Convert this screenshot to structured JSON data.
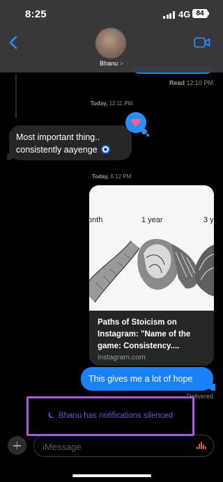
{
  "status_bar": {
    "time": "8:25",
    "network": "4G",
    "battery": "84"
  },
  "header": {
    "contact_name": "Bhanu",
    "contact_chevron": ">"
  },
  "messages": {
    "read_receipt_label": "Read",
    "read_receipt_time": "12:10 PM",
    "timestamp_1_day": "Today,",
    "timestamp_1_time": "12:11 PM",
    "incoming_text": "Most important thing.. consistently aayenge",
    "tapback": "heart",
    "timestamp_2_day": "Today,",
    "timestamp_2_time": "6:12 PM",
    "link_preview": {
      "image_labels": [
        "onth",
        "1 year",
        "3 y"
      ],
      "title": "Paths of Stoicism on Instagram: \"Name of the game: Consistency....",
      "domain": "instagram.com"
    },
    "outgoing_text": "This gives me a lot of hope",
    "delivered": "Delivered"
  },
  "notice": {
    "silenced": "Bhanu has notifications silenced"
  },
  "composer": {
    "placeholder": "iMessage"
  },
  "colors": {
    "accent_blue": "#1a82f8",
    "highlight_purple": "#a25fd8",
    "notice_indigo": "#5a59d8",
    "audio_orange": "#e05c3c"
  },
  "icons": {
    "back": "chevron-left-icon",
    "video": "video-camera-icon",
    "moon": "moon-icon",
    "plus": "plus-icon",
    "audio": "audio-waveform-icon",
    "heart": "heart-icon",
    "eye": "nazar-eye-emoji"
  }
}
